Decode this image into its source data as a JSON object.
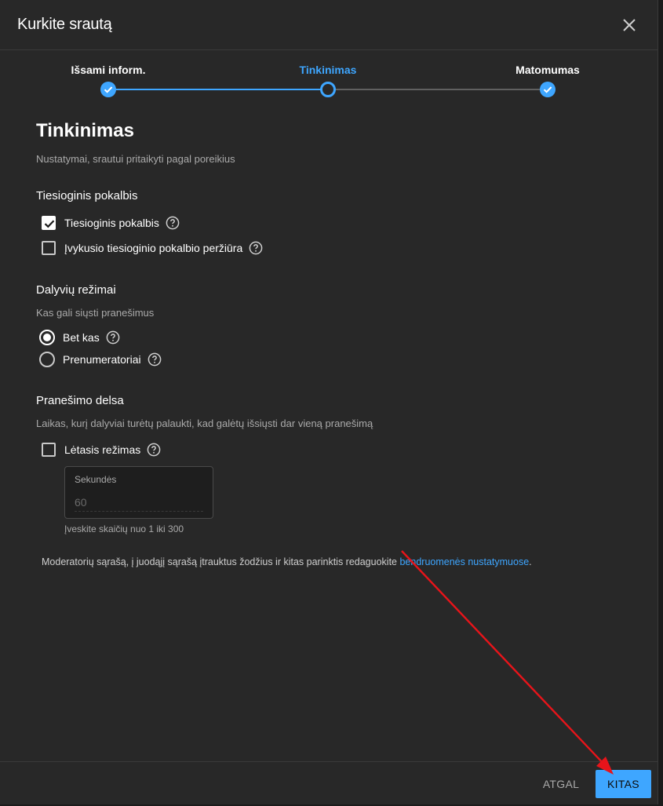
{
  "dialog": {
    "title": "Kurkite srautą",
    "close_icon": "close-icon"
  },
  "stepper": {
    "steps": [
      {
        "label": "Išsami inform.",
        "state": "done"
      },
      {
        "label": "Tinkinimas",
        "state": "current"
      },
      {
        "label": "Matomumas",
        "state": "done"
      }
    ]
  },
  "page": {
    "title": "Tinkinimas",
    "subtitle": "Nustatymai, srautui pritaikyti pagal poreikius"
  },
  "live_chat": {
    "title": "Tiesioginis pokalbis",
    "options": [
      {
        "label": "Tiesioginis pokalbis",
        "checked": true
      },
      {
        "label": "Įvykusio tiesioginio pokalbio peržiūra",
        "checked": false
      }
    ]
  },
  "participant_modes": {
    "title": "Dalyvių režimai",
    "subtitle": "Kas gali siųsti pranešimus",
    "options": [
      {
        "label": "Bet kas",
        "selected": true
      },
      {
        "label": "Prenumeratoriai",
        "selected": false
      }
    ]
  },
  "message_delay": {
    "title": "Pranešimo delsa",
    "subtitle": "Laikas, kurį dalyviai turėtų palaukti, kad galėtų išsiųsti dar vieną pranešimą",
    "slow_mode_label": "Lėtasis režimas",
    "slow_mode_checked": false,
    "seconds_label": "Sekundės",
    "seconds_placeholder": "60",
    "seconds_hint": "Įveskite skaičių nuo 1 iki 300"
  },
  "moderators": {
    "text": "Moderatorių sąrašą, į juodąjį sąrašą įtrauktus žodžius ir kitas parinktis redaguokite ",
    "link": "bendruomenės nustatymuose",
    "suffix": "."
  },
  "footer": {
    "back_label": "ATGAL",
    "next_label": "KITAS"
  },
  "colors": {
    "accent": "#3ea6ff",
    "background": "#282828",
    "annotation_arrow": "#e8141a"
  }
}
